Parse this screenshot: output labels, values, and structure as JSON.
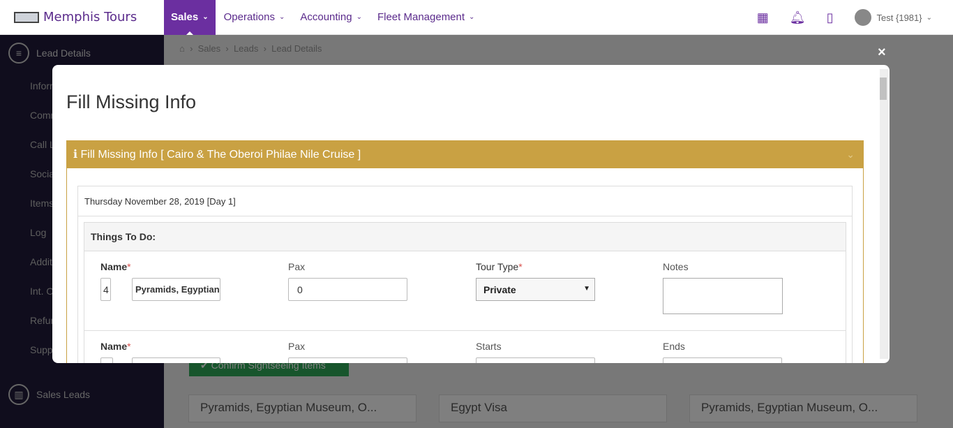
{
  "brand": {
    "name": "Memphis Tours"
  },
  "nav": {
    "items": [
      {
        "label": "Sales"
      },
      {
        "label": "Operations"
      },
      {
        "label": "Accounting"
      },
      {
        "label": "Fleet Management"
      }
    ],
    "user": "Test {1981}"
  },
  "sidebar": {
    "header": "Lead Details",
    "items": [
      "Information",
      "Communication",
      "Call Log",
      "Social",
      "Items",
      "Log",
      "Additional",
      "Int. Offer",
      "Refunds",
      "Support"
    ],
    "bottom": "Sales Leads"
  },
  "breadcrumb": {
    "home": "⌂",
    "items": [
      "Sales",
      "Leads",
      "Lead Details"
    ]
  },
  "background": {
    "confirm_button": "✔ Confirm Sightseeing Items",
    "cards": [
      "Pyramids, Egyptian Museum, O...",
      "Egypt Visa",
      "Pyramids, Egyptian Museum, O..."
    ]
  },
  "modal": {
    "close": "×",
    "title": "Fill Missing Info",
    "panel_title": "ℹ Fill Missing Info [ Cairo & The Oberoi Philae Nile Cruise ]",
    "day": "Thursday November 28, 2019 [Day 1]",
    "section": "Things To Do:",
    "row1": {
      "name_label": "Name",
      "num": "4",
      "name_value": "Pyramids, Egyptian Museum, Old Cairo",
      "pax_label": "Pax",
      "pax": "0",
      "tour_type_label": "Tour Type",
      "tour_type": "Private",
      "notes_label": "Notes"
    },
    "row2": {
      "name_label": "Name",
      "pax_label": "Pax",
      "starts_label": "Starts",
      "ends_label": "Ends"
    }
  },
  "colors": {
    "brand": "#6b2fa0",
    "panel": "#c9a143",
    "sidebar": "#201a3a"
  }
}
